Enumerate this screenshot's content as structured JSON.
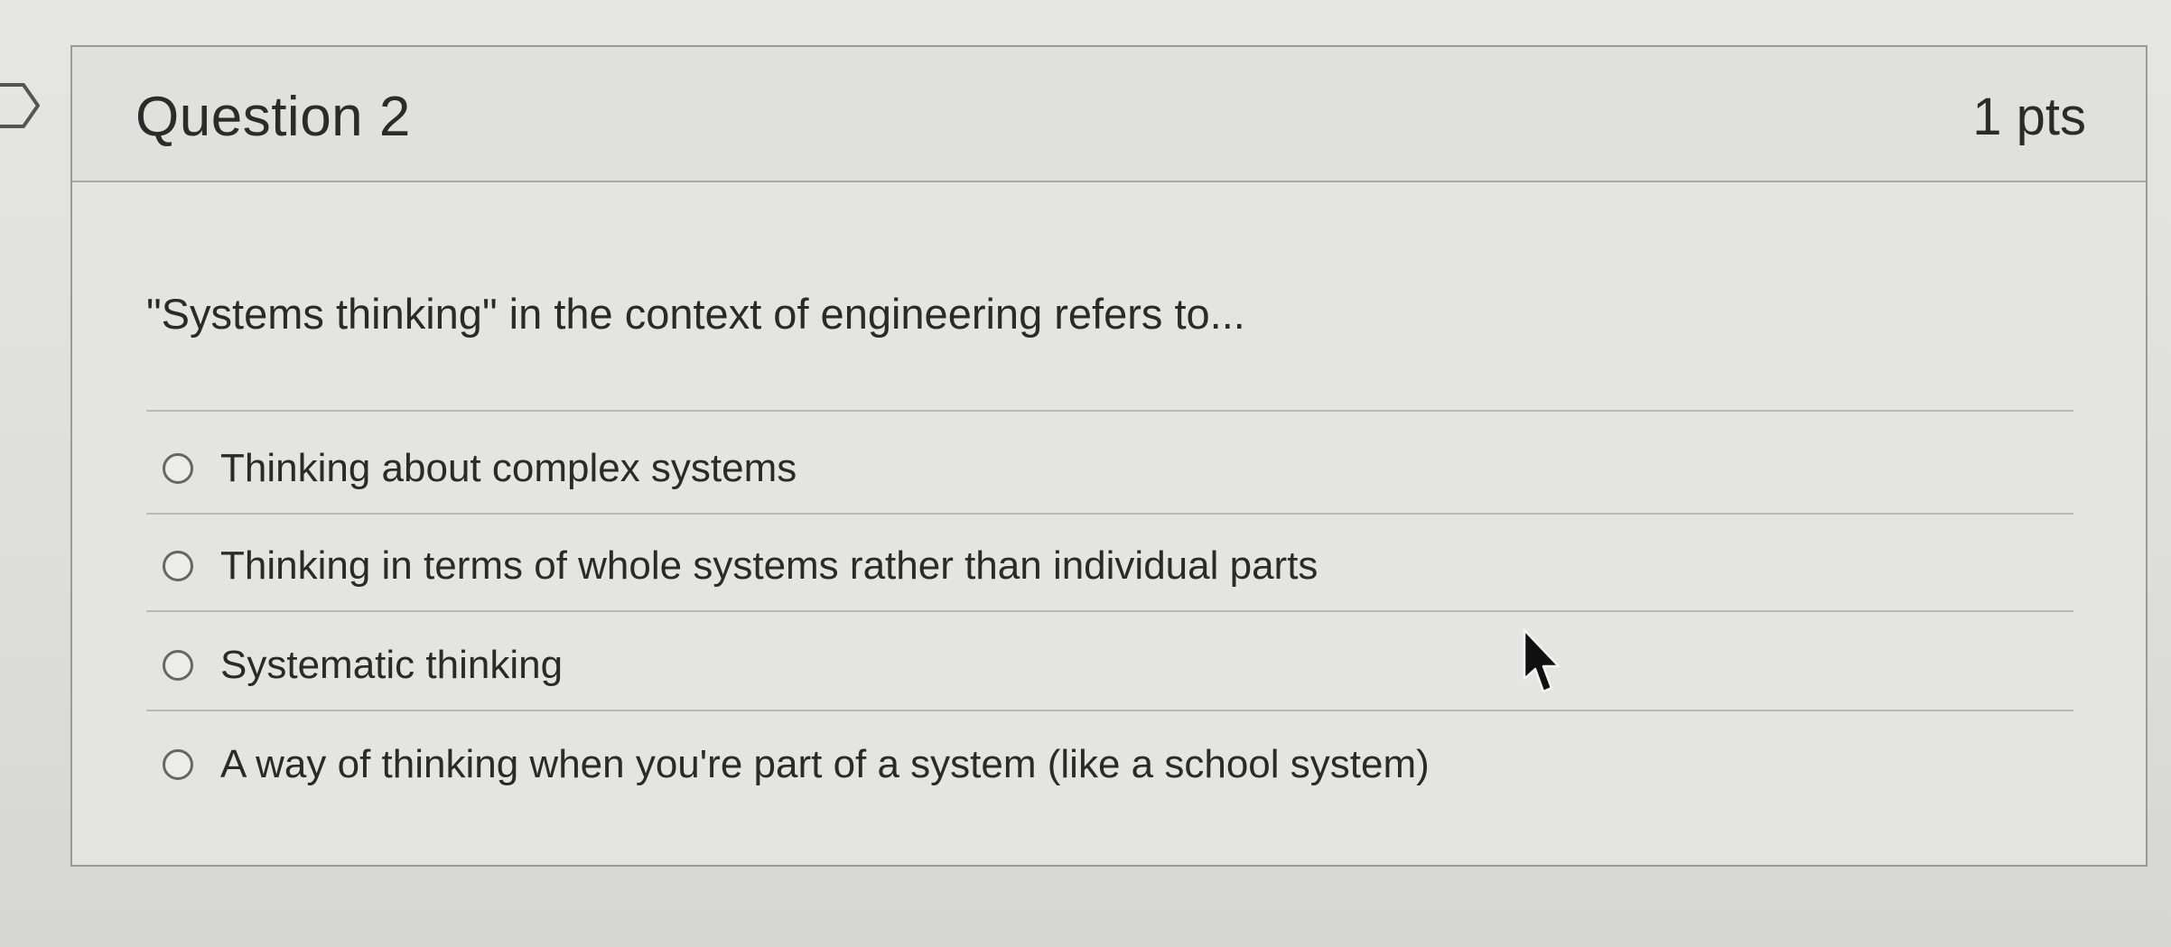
{
  "question": {
    "title": "Question 2",
    "points": "1 pts",
    "text": "\"Systems thinking\" in the context of engineering refers to...",
    "answers": [
      {
        "label": "Thinking about complex systems",
        "selected": false
      },
      {
        "label": "Thinking in terms of whole systems rather than individual parts",
        "selected": false
      },
      {
        "label": "Systematic thinking",
        "selected": false
      },
      {
        "label": "A way of thinking when you're part of a system (like a school system)",
        "selected": false
      }
    ]
  },
  "icons": {
    "flag": "bookmark-flag-icon",
    "radio": "radio-button-icon",
    "cursor": "mouse-pointer-icon"
  },
  "colors": {
    "text": "#2a2a2a",
    "border": "#9a9a98",
    "background": "#e4e4e2"
  }
}
